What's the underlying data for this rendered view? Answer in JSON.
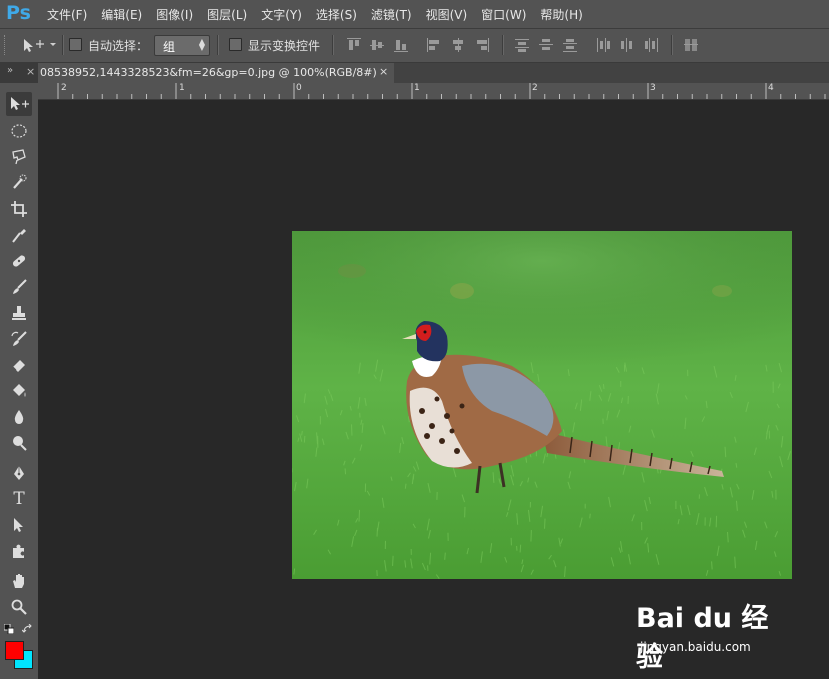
{
  "app": {
    "logo": "Ps"
  },
  "menu": [
    "文件(F)",
    "编辑(E)",
    "图像(I)",
    "图层(L)",
    "文字(Y)",
    "选择(S)",
    "滤镜(T)",
    "视图(V)",
    "窗口(W)",
    "帮助(H)"
  ],
  "options": {
    "auto_select_label": "自动选择：",
    "auto_select_value": "组",
    "show_transform_label": "显示变换控件"
  },
  "document": {
    "tab_title": "08538952,1443328523&fm=26&gp=0.jpg @ 100%(RGB/8#)",
    "close": "×"
  },
  "panel_tab": {
    "collapse": "»",
    "close": "×"
  },
  "ruler": {
    "labels": [
      "2",
      "1",
      "0",
      "1",
      "2",
      "3",
      "4"
    ]
  },
  "tools": [
    "move-tool",
    "marquee-tool",
    "lasso-tool",
    "quick-selection-tool",
    "crop-tool",
    "eyedropper-tool",
    "spot-healing-tool",
    "brush-tool",
    "clone-stamp-tool",
    "history-brush-tool",
    "eraser-tool",
    "paint-bucket-tool",
    "blur-tool",
    "dodge-tool",
    "pen-tool",
    "type-tool",
    "path-selection-tool",
    "custom-shape-tool",
    "hand-tool",
    "zoom-tool"
  ],
  "type_tool_glyph": "T",
  "colors": {
    "foreground": "#ff0000",
    "background": "#00e5ff",
    "accent": "#3fa9e8"
  },
  "watermark": {
    "main": "Bai du 经验",
    "sub": "jingyan.baidu.com"
  }
}
